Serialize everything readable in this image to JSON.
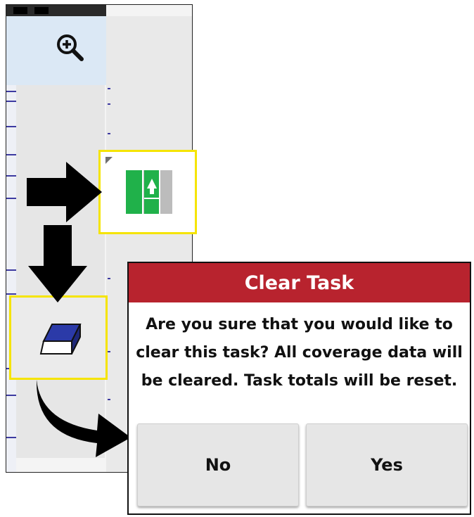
{
  "dialog": {
    "title": "Clear Task",
    "message": "Are you sure that you would like to clear this task? All coverage data will be cleared. Task totals will be reset.",
    "no_label": "No",
    "yes_label": "Yes",
    "title_color": "#b8232e"
  },
  "icons": {
    "zoom": "zoom-in-icon",
    "coverage": "coverage-toggle-icon",
    "clear": "eraser-icon"
  },
  "colors": {
    "highlight_border": "#f5e400",
    "coverage_green": "#20b14a",
    "eraser_blue": "#2b3aa8"
  }
}
